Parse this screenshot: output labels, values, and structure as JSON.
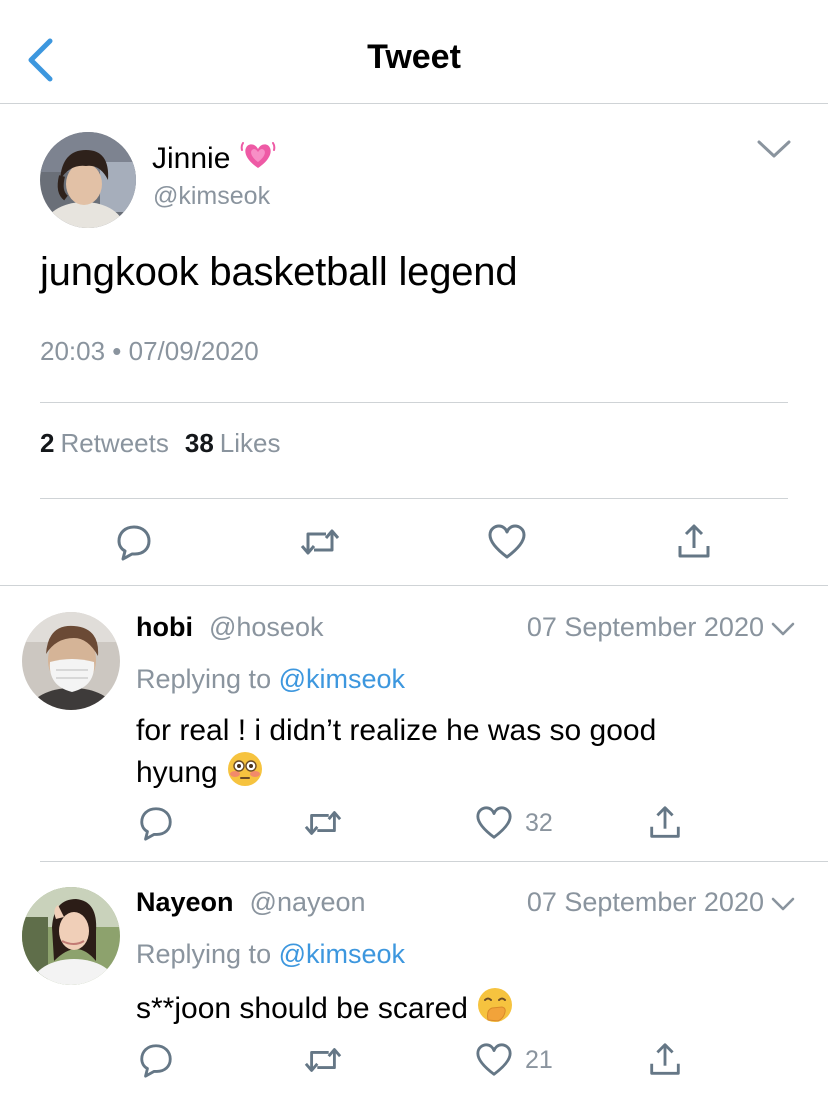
{
  "nav": {
    "title": "Tweet",
    "back_icon": "chevron-left-icon"
  },
  "tweet": {
    "name": "Jinnie",
    "name_emoji": "💓",
    "handle": "@kimseok",
    "text": "jungkook basketball legend",
    "timestamp": "20:03 • 07/09/2020",
    "retweets_count": "2",
    "retweets_label": "Retweets",
    "likes_count": "38",
    "likes_label": "Likes"
  },
  "replies": [
    {
      "name": "hobi",
      "handle": "@hoseok",
      "date": "07 September 2020",
      "replying_prefix": "Replying to",
      "replying_to": "@kimseok",
      "text_line1": "for real ! i didn’t realize he was so good",
      "text_line2": "hyung",
      "emoji": "😳",
      "like_count": "32"
    },
    {
      "name": "Nayeon",
      "handle": "@nayeon",
      "date": "07 September 2020",
      "replying_prefix": "Replying to",
      "replying_to": "@kimseok",
      "text_line1": "s**joon should be scared",
      "emoji": "🤭",
      "like_count": "21"
    }
  ],
  "colors": {
    "accent": "#3d97de",
    "icon_gray": "#657786",
    "muted_text": "#8a949e",
    "divider": "#cfd3d6"
  }
}
